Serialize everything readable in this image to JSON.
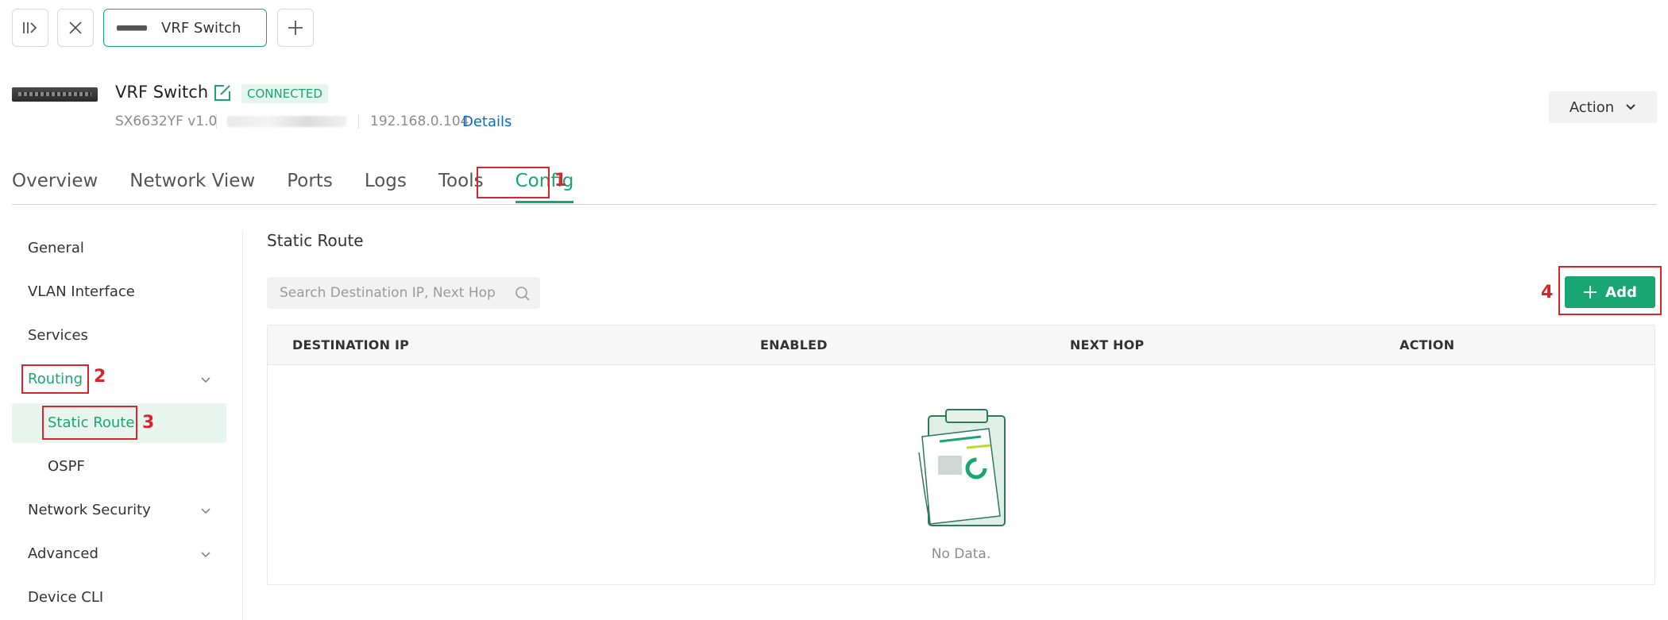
{
  "window_tab": {
    "label": "VRF Switch"
  },
  "device": {
    "name": "VRF Switch",
    "status": "CONNECTED",
    "model": "SX6632YF v1.0",
    "ip": "192.168.0.104",
    "details_label": "Details"
  },
  "action_button": {
    "label": "Action"
  },
  "main_tabs": [
    {
      "label": "Overview"
    },
    {
      "label": "Network View"
    },
    {
      "label": "Ports"
    },
    {
      "label": "Logs"
    },
    {
      "label": "Tools"
    },
    {
      "label": "Config"
    }
  ],
  "sidebar": {
    "items": [
      {
        "label": "General"
      },
      {
        "label": "VLAN Interface"
      },
      {
        "label": "Services"
      },
      {
        "label": "Routing"
      },
      {
        "label": "Static Route"
      },
      {
        "label": "OSPF"
      },
      {
        "label": "Network Security"
      },
      {
        "label": "Advanced"
      },
      {
        "label": "Device CLI"
      }
    ]
  },
  "content": {
    "title": "Static Route",
    "search_placeholder": "Search Destination IP, Next Hop",
    "add_label": "Add",
    "columns": [
      "DESTINATION IP",
      "ENABLED",
      "NEXT HOP",
      "ACTION"
    ],
    "empty_text": "No Data."
  },
  "annotations": [
    "1",
    "2",
    "3",
    "4"
  ],
  "colors": {
    "accent": "#19a673",
    "annotation": "#d9242b",
    "link": "#0b6bcb"
  }
}
